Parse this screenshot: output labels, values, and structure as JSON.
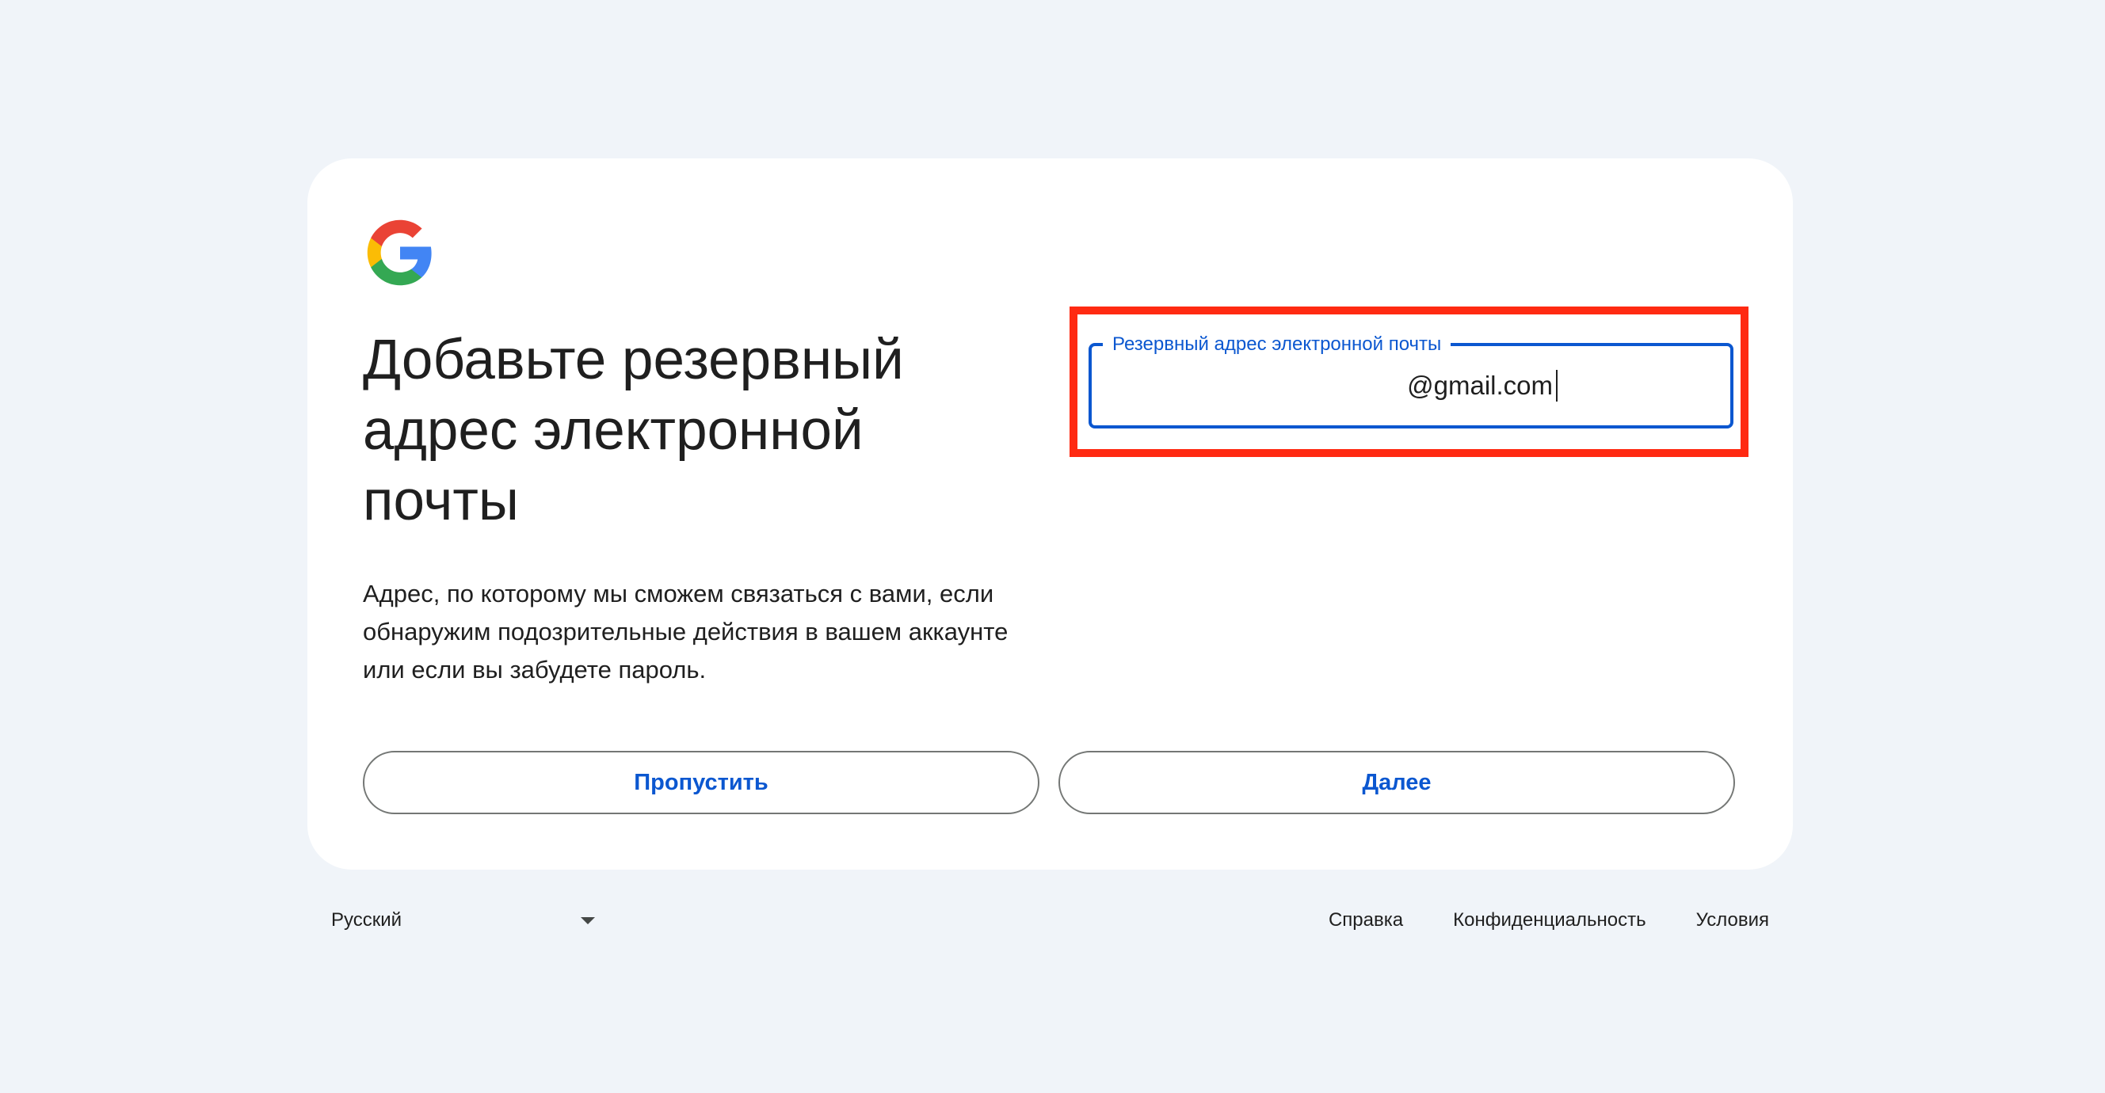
{
  "logo": {
    "icon": "google-g-logo"
  },
  "heading": {
    "title": "Добавьте резервный адрес электронной почты",
    "description": "Адрес, по которому мы сможем связаться с вами, если обнаружим подозрительные действия в вашем аккаунте или если вы забудете пароль."
  },
  "email_field": {
    "label": "Резервный адрес электронной почты",
    "value": "@gmail.com"
  },
  "buttons": {
    "skip": "Пропустить",
    "next": "Далее"
  },
  "footer": {
    "language": "Русский",
    "links": [
      "Справка",
      "Конфиденциальность",
      "Условия"
    ]
  },
  "colors": {
    "background": "#f0f4f9",
    "accent": "#0b57d0",
    "highlight": "#ff2a12"
  }
}
